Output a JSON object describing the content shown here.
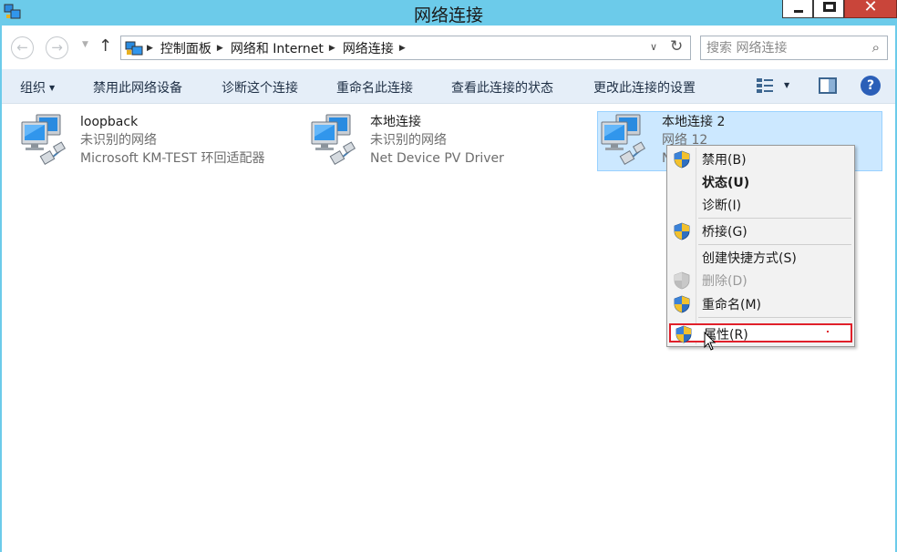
{
  "window": {
    "title": "网络连接",
    "controls": {
      "minimize": "minimize",
      "maximize": "maximize",
      "close": "✕"
    }
  },
  "address_bar": {
    "breadcrumbs": [
      "控制面板",
      "网络和 Internet",
      "网络连接"
    ],
    "search_placeholder": "搜索 网络连接"
  },
  "command_bar": {
    "organize": "组织",
    "items": [
      "禁用此网络设备",
      "诊断这个连接",
      "重命名此连接",
      "查看此连接的状态",
      "更改此连接的设置"
    ],
    "help": "?"
  },
  "connections": [
    {
      "name": "loopback",
      "network": "未识别的网络",
      "device": "Microsoft KM-TEST 环回适配器",
      "selected": false
    },
    {
      "name": "本地连接",
      "network": "未识别的网络",
      "device": "Net Device PV Driver",
      "selected": false
    },
    {
      "name": "本地连接 2",
      "network": "网络 12",
      "device": "N",
      "selected": true
    }
  ],
  "context_menu": {
    "items": [
      {
        "label": "禁用(B)",
        "icon": "shield-icon",
        "style": "normal"
      },
      {
        "label": "状态(U)",
        "icon": "",
        "style": "bold"
      },
      {
        "label": "诊断(I)",
        "icon": "",
        "style": "normal"
      },
      {
        "label": "桥接(G)",
        "icon": "shield-icon",
        "style": "normal"
      },
      {
        "label": "创建快捷方式(S)",
        "icon": "",
        "style": "normal"
      },
      {
        "label": "删除(D)",
        "icon": "shield-icon",
        "style": "disabled"
      },
      {
        "label": "重命名(M)",
        "icon": "shield-icon",
        "style": "normal"
      },
      {
        "label": "属性(R)",
        "icon": "shield-icon",
        "style": "highlighted"
      }
    ]
  },
  "colors": {
    "titlebar": "#6ccbea",
    "command_bar": "#e5eef8",
    "selection": "#cce8ff",
    "highlight_border": "#e0202a",
    "close_button": "#c9453a"
  }
}
